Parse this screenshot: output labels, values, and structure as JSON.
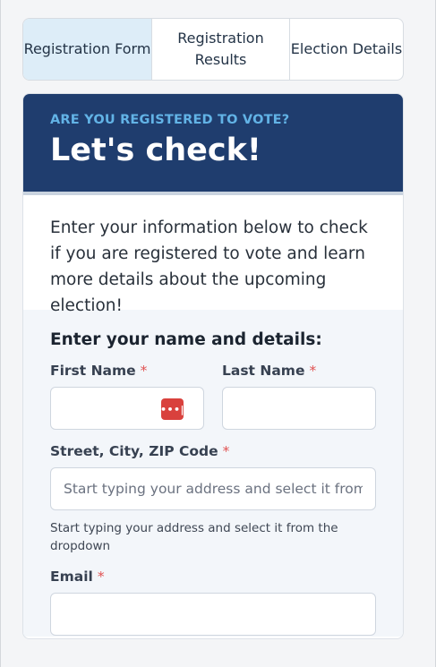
{
  "tabs": [
    {
      "label": "Registration Form",
      "active": true
    },
    {
      "label": "Registration Results",
      "active": false
    },
    {
      "label": "Election Details",
      "active": false
    }
  ],
  "hero": {
    "eyebrow": "ARE YOU REGISTERED TO VOTE?",
    "title": "Let's check!"
  },
  "intro": "Enter your information below to check if you are registered to vote and learn more details about the upcoming election!",
  "form": {
    "heading": "Enter your name and details:",
    "required_mark": "*",
    "first_name": {
      "label": "First Name",
      "value": ""
    },
    "last_name": {
      "label": "Last Name",
      "value": ""
    },
    "address": {
      "label": "Street, City, ZIP Code",
      "placeholder": "Start typing your address and select it from the dropdown",
      "hint": "Start typing your address and select it from the dropdown"
    },
    "email": {
      "label": "Email",
      "value": ""
    }
  },
  "icons": {
    "password_manager": "password-manager-icon",
    "password_manager_glyph": "•••|",
    "password_manager_color": "#d9413d"
  },
  "colors": {
    "hero_bg": "#1f3d6e",
    "eyebrow": "#62b3e6",
    "active_tab": "#ddedf8",
    "required": "#e05252"
  }
}
